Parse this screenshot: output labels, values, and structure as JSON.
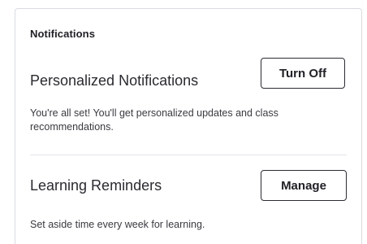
{
  "notifications": {
    "section_title": "Notifications",
    "personalized": {
      "label": "Personalized Notifications",
      "button_label": "Turn Off",
      "description": "You're all set! You'll get personalized updates and class recommendations."
    },
    "reminders": {
      "label": "Learning Reminders",
      "button_label": "Manage",
      "description": "Set aside time every week for learning."
    }
  }
}
